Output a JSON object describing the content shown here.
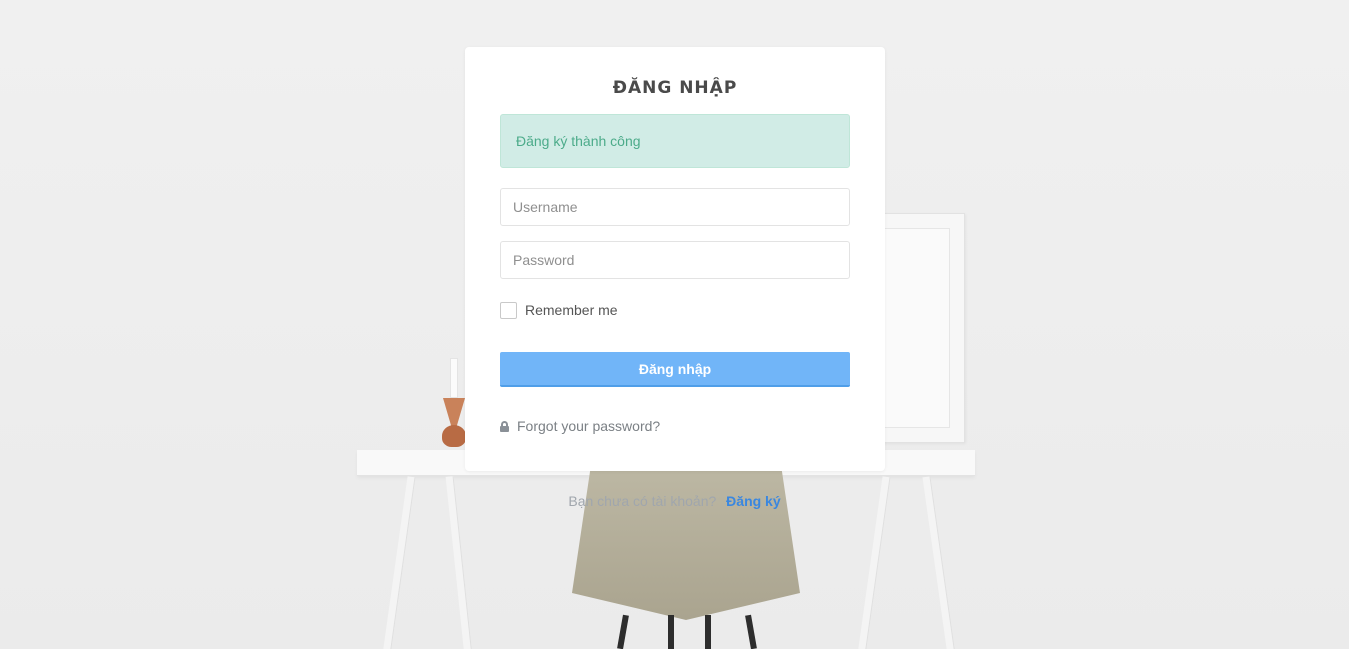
{
  "login": {
    "title": "ĐĂNG NHẬP",
    "alert_message": "Đăng ký thành công",
    "username_placeholder": "Username",
    "password_placeholder": "Password",
    "remember_label": "Remember me",
    "remember_checked": false,
    "submit_label": "Đăng nhập",
    "forgot_label": "Forgot your password?"
  },
  "footer": {
    "prompt": "Bạn chưa có tài khoản?",
    "register_link": "Đăng ký"
  },
  "colors": {
    "accent": "#71b5f8",
    "link": "#3a87e0",
    "success_bg": "#d1ece6",
    "success_text": "#4cab8a"
  },
  "icons": {
    "forgot": "lock-icon"
  }
}
